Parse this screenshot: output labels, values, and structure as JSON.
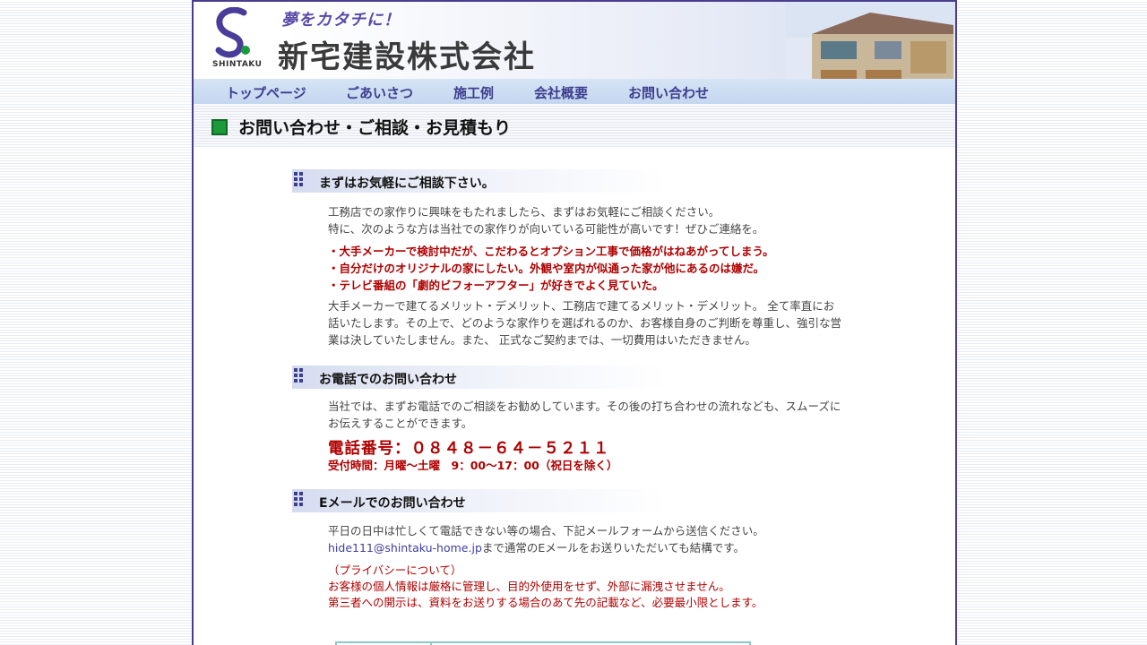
{
  "header": {
    "logo_text": "SHINTAKU",
    "catchphrase": "夢をカタチに！",
    "company_name": "新宅建設株式会社"
  },
  "nav": {
    "items": [
      {
        "label": "トップページ"
      },
      {
        "label": "ごあいさつ"
      },
      {
        "label": "施工例"
      },
      {
        "label": "会社概要"
      },
      {
        "label": "お問い合わせ"
      }
    ]
  },
  "page_title": "お問い合わせ・ご相談・お見積もり",
  "section1": {
    "title": "まずはお気軽にご相談下さい。",
    "intro_line1": "工務店での家作りに興味をもたれましたら、まずはお気軽にご相談ください。",
    "intro_line2": "特に、次のような方は当社での家作りが向いている可能性が高いです！ぜひご連絡を。",
    "bullets": [
      "・大手メーカーで検討中だが、こだわるとオプション工事で価格がはねあがってしまう。",
      "・自分だけのオリジナルの家にしたい。外観や室内が似通った家が他にあるのは嫌だ。",
      "・テレビ番組の「劇的ビフォーアフター」が好きでよく見ていた。"
    ],
    "body_line1": "大手メーカーで建てるメリット・デメリット、工務店で建てるメリット・デメリット。 全て率直にお",
    "body_line2": "話いたします。その上で、どのような家作りを選ばれるのか、お客様自身のご判断を尊重し、強引な営",
    "body_line3": "業は決していたしません。また、 正式なご契約までは、一切費用はいただきません。"
  },
  "section2": {
    "title": "お電話でのお問い合わせ",
    "body_line1": "当社では、まずお電話でのご相談をお勧めしています。その後の打ち合わせの流れなども、スムーズに",
    "body_line2": "お伝えすることができます。",
    "tel_label": "電話番号：０８４８－６４－５２１１",
    "hours": "受付時間：月曜～土曜　9：00～17：00（祝日を除く）"
  },
  "section3": {
    "title": "Eメールでのお問い合わせ",
    "body_line1": "平日の日中は忙しくて電話できない等の場合、下記メールフォームから送信ください。",
    "email": "hide111@shintaku-home.jp",
    "body_line2_suffix": "まで通常のEメールをお送りいただいても結構です。",
    "privacy_title": "（プライバシーについて）",
    "privacy_line1": "お客様の個人情報は厳格に管理し、目的外使用をせず、外部に漏洩させません。",
    "privacy_line2": "第三者への開示は、資料をお送りする場合のあて先の記載など、必要最小限とします。"
  },
  "colors": {
    "accent_purple": "#3d3d8e",
    "emphasis_red": "#b00000",
    "title_green": "#1a9a3a"
  }
}
